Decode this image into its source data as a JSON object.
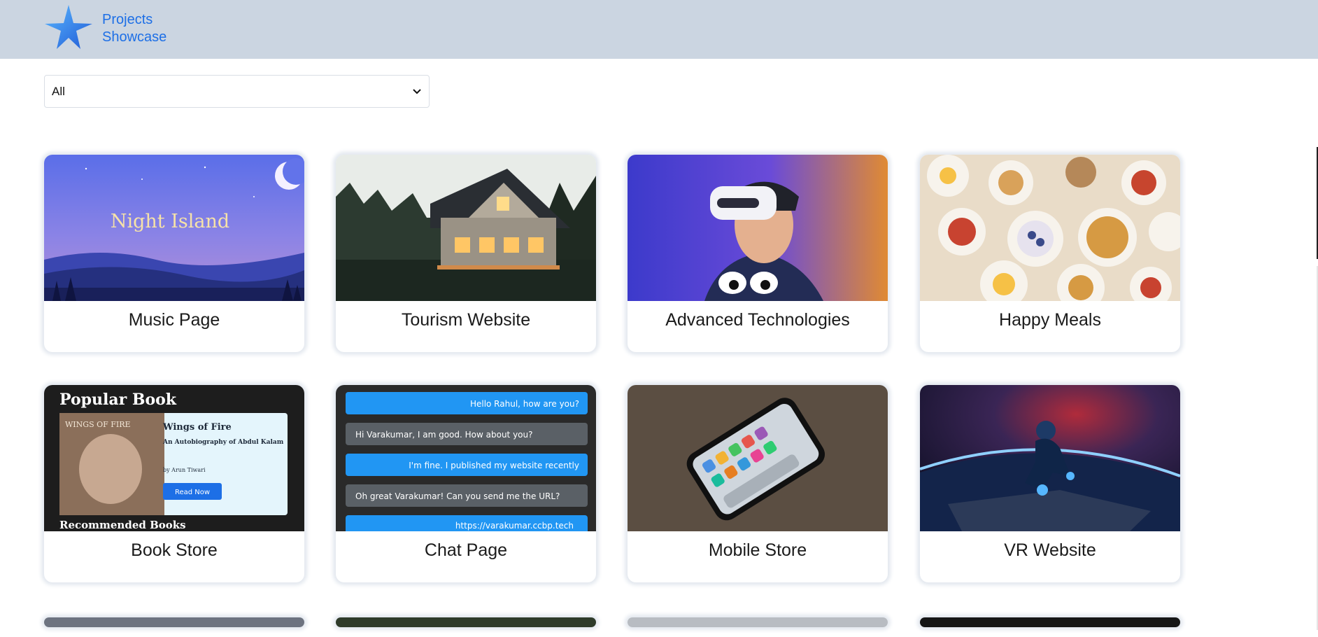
{
  "header": {
    "brand_line1": "Projects",
    "brand_line2": "Showcase",
    "logo_icon": "star-logo-icon",
    "bg": "#cbd5e1"
  },
  "filter": {
    "selected": "All"
  },
  "thumbnails": {
    "music": {
      "banner": "Night Island"
    },
    "book": {
      "heading": "Popular Book",
      "cover": "WINGS OF FIRE",
      "title": "Wings of Fire",
      "subtitle": "An Autobiography of Abdul Kalam",
      "author": "by Arun Tiwari",
      "button": "Read Now",
      "footer": "Recommended Books"
    },
    "chat": {
      "m1": "Hello Rahul, how are you?",
      "m2": "Hi Varakumar, I am good. How about you?",
      "m3": "I'm fine. I published my website recently",
      "m4": "Oh great Varakumar! Can you send me the URL?",
      "m5": "https://varakumar.ccbp.tech"
    }
  },
  "projects": [
    {
      "title": "Music Page"
    },
    {
      "title": "Tourism Website"
    },
    {
      "title": "Advanced Technologies"
    },
    {
      "title": "Happy Meals"
    },
    {
      "title": "Book Store"
    },
    {
      "title": "Chat Page"
    },
    {
      "title": "Mobile Store"
    },
    {
      "title": "VR Website"
    }
  ]
}
